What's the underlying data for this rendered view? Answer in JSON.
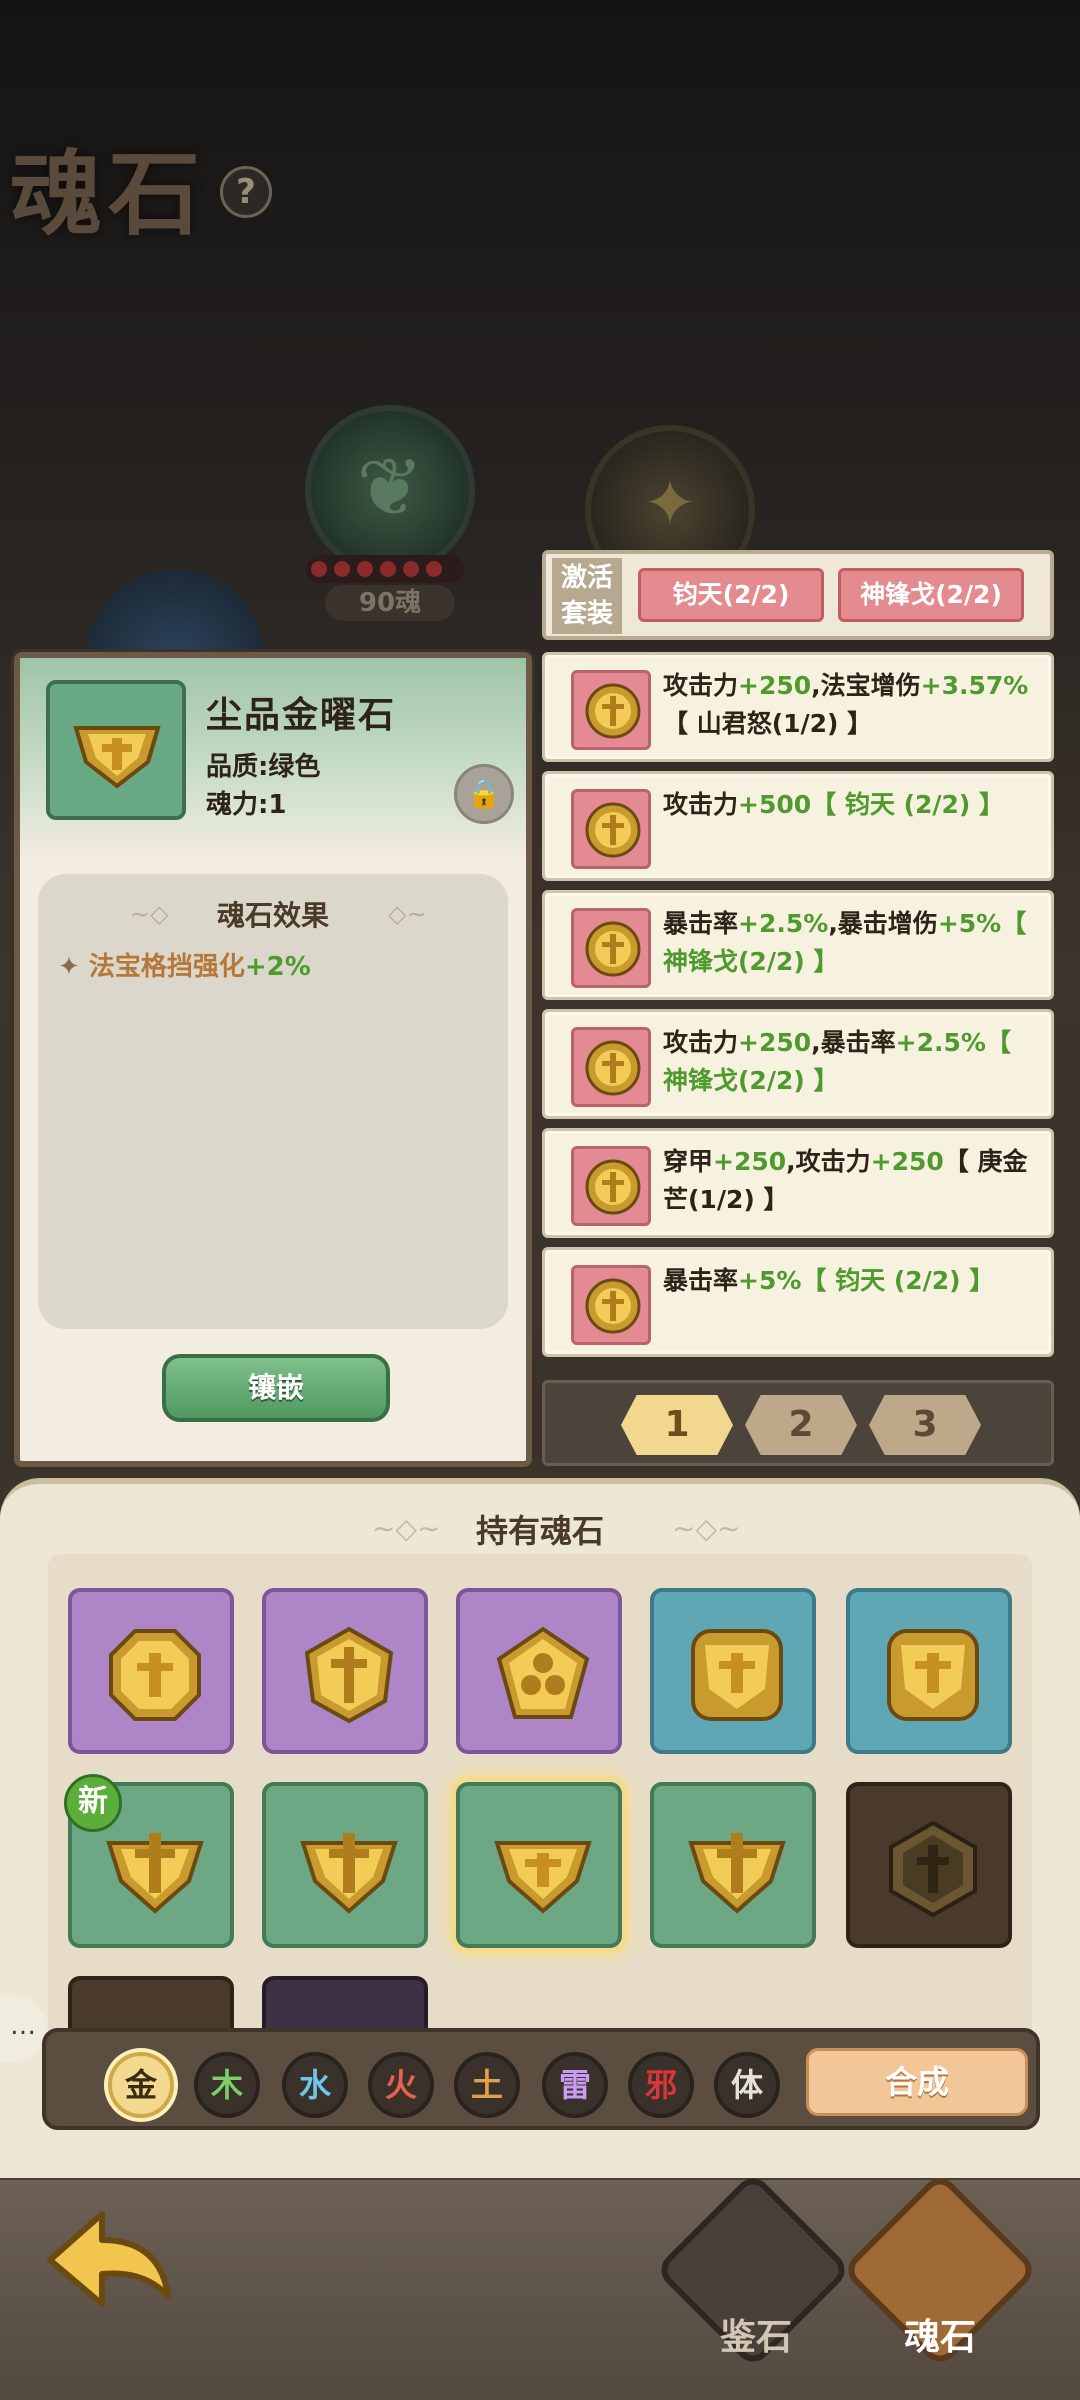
{
  "page": {
    "title": "魂石",
    "help_icon": "question-mark-icon"
  },
  "background": {
    "orb_count_label": "90魂"
  },
  "detail": {
    "name": "尘品金曜石",
    "quality": "品质:绿色",
    "soul_power": "魂力:1",
    "lock_icon": "lock-icon",
    "effect_title": "魂石效果",
    "effect_star": "✦",
    "effect_name": "法宝格挡强化",
    "effect_value": "+2%",
    "inlay_button": "镶嵌"
  },
  "suite": {
    "label_line1": "激活",
    "label_line2": "套装",
    "tags": [
      "钧天(2/2)",
      "神锋戈(2/2)"
    ]
  },
  "stone_list": [
    {
      "text_parts": [
        [
          "k",
          "攻击力"
        ],
        [
          "g",
          "+250"
        ],
        [
          "k",
          ",法宝增伤"
        ],
        [
          "g",
          "+3.57%"
        ],
        [
          "k",
          "【 山君怒(1/2) 】"
        ]
      ]
    },
    {
      "text_parts": [
        [
          "k",
          "攻击力"
        ],
        [
          "g",
          "+500"
        ],
        [
          "g",
          "【 钧天 (2/2) 】"
        ]
      ]
    },
    {
      "text_parts": [
        [
          "k",
          "暴击率"
        ],
        [
          "g",
          "+2.5%"
        ],
        [
          "k",
          ",暴击增伤"
        ],
        [
          "g",
          "+5%"
        ],
        [
          "g",
          "【 神锋戈(2/2) 】"
        ]
      ]
    },
    {
      "text_parts": [
        [
          "k",
          "攻击力"
        ],
        [
          "g",
          "+250"
        ],
        [
          "k",
          ",暴击率"
        ],
        [
          "g",
          "+2.5%"
        ],
        [
          "g",
          "【 神锋戈(2/2) 】"
        ]
      ]
    },
    {
      "text_parts": [
        [
          "k",
          "穿甲"
        ],
        [
          "g",
          "+250"
        ],
        [
          "k",
          ",攻击力"
        ],
        [
          "g",
          "+250"
        ],
        [
          "k",
          "【 庚金芒(1/2) 】"
        ]
      ]
    },
    {
      "text_parts": [
        [
          "k",
          "暴击率"
        ],
        [
          "g",
          "+5%"
        ],
        [
          "g",
          "【 钧天 (2/2) 】"
        ]
      ]
    }
  ],
  "pager": {
    "pages": [
      "1",
      "2",
      "3"
    ],
    "active_page": "1"
  },
  "inventory": {
    "title": "持有魂石",
    "new_badge": "新",
    "slots": [
      {
        "color": "purple",
        "icon": "octagon-rune-icon"
      },
      {
        "color": "purple",
        "icon": "sword-shield-icon"
      },
      {
        "color": "purple",
        "icon": "triskelion-icon"
      },
      {
        "color": "teal",
        "icon": "square-rune-icon"
      },
      {
        "color": "teal",
        "icon": "square-rune-icon"
      },
      {
        "color": "green",
        "icon": "sword-gem-icon",
        "is_new": true
      },
      {
        "color": "green",
        "icon": "sword-gem-icon"
      },
      {
        "color": "green",
        "icon": "shield-gem-icon",
        "selected": true
      },
      {
        "color": "green",
        "icon": "sword-gem-icon"
      },
      {
        "color": "dark",
        "icon": "sword-hexagon-icon"
      },
      {
        "color": "dark",
        "icon": "partial-slot-icon"
      },
      {
        "color": "dark-purple",
        "icon": "partial-slot-icon"
      }
    ]
  },
  "filters": {
    "elements": [
      {
        "label": "金",
        "color": "#f3d98f",
        "active": true
      },
      {
        "label": "木",
        "color": "#7dcf6e"
      },
      {
        "label": "水",
        "color": "#6ec7e6"
      },
      {
        "label": "火",
        "color": "#e9604f"
      },
      {
        "label": "土",
        "color": "#e0a14a"
      },
      {
        "label": "雷",
        "color": "#c89cf0"
      },
      {
        "label": "邪",
        "color": "#d9363a"
      },
      {
        "label": "体",
        "color": "#e5e2dc"
      }
    ],
    "merge_button": "合成"
  },
  "bottom_nav": {
    "back_icon": "back-arrow-icon",
    "items": [
      {
        "label": "鉴石",
        "icon": "eye-swirl-icon"
      },
      {
        "label": "魂石",
        "icon": "soul-gem-icon",
        "active": true
      }
    ]
  },
  "chat_icon": "chat-bubble-icon"
}
